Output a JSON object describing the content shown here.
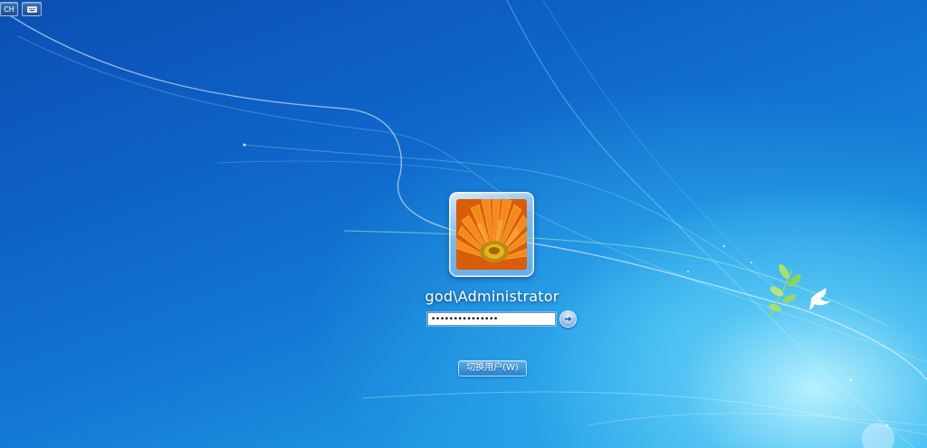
{
  "tray": {
    "language_label": "CH",
    "keyboard_icon": "keyboard-icon"
  },
  "login": {
    "username": "god\\Administrator",
    "password_value": "•••••••••••••••",
    "submit_icon": "arrow-right-icon",
    "switch_user_label": "切换用户(W)"
  },
  "colors": {
    "wallpaper_dark": "#0b4fb3",
    "wallpaper_light": "#2aa8ea",
    "flower_orange": "#f57a10",
    "flower_center": "#e0a010"
  }
}
